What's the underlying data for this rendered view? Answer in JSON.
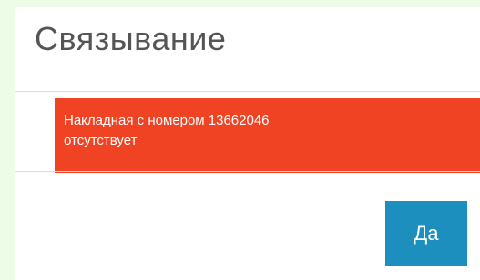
{
  "dialog": {
    "title": "Связывание",
    "alert": {
      "line1": "Накладная с номером 13662046",
      "line2": "отсутствует",
      "color": "#f04324"
    },
    "confirm_label": "Да",
    "confirm_color": "#1d8fbf"
  }
}
